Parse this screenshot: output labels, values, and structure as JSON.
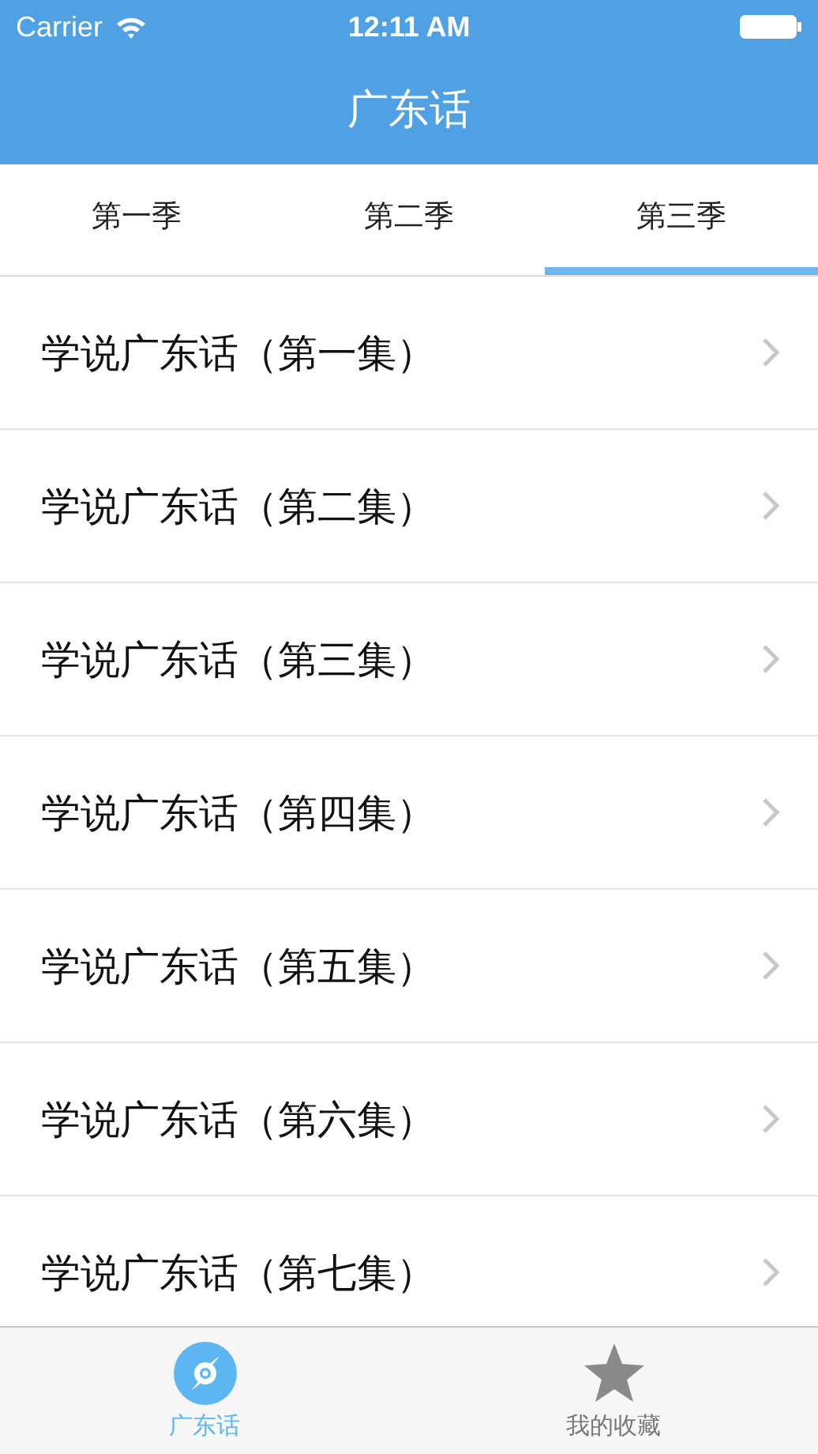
{
  "status_bar": {
    "carrier": "Carrier",
    "time": "12:11 AM"
  },
  "nav_bar": {
    "title": "广东话"
  },
  "tabs": [
    {
      "label": "第一季",
      "selected": false
    },
    {
      "label": "第二季",
      "selected": false
    },
    {
      "label": "第三季",
      "selected": true
    }
  ],
  "episodes": [
    {
      "title": "学说广东话（第一集）"
    },
    {
      "title": "学说广东话（第二集）"
    },
    {
      "title": "学说广东话（第三集）"
    },
    {
      "title": "学说广东话（第四集）"
    },
    {
      "title": "学说广东话（第五集）"
    },
    {
      "title": "学说广东话（第六集）"
    },
    {
      "title": "学说广东话（第七集）"
    }
  ],
  "tab_bar": [
    {
      "label": "广东话",
      "kind": "disc",
      "selected": true
    },
    {
      "label": "我的收藏",
      "kind": "star",
      "selected": false
    }
  ]
}
